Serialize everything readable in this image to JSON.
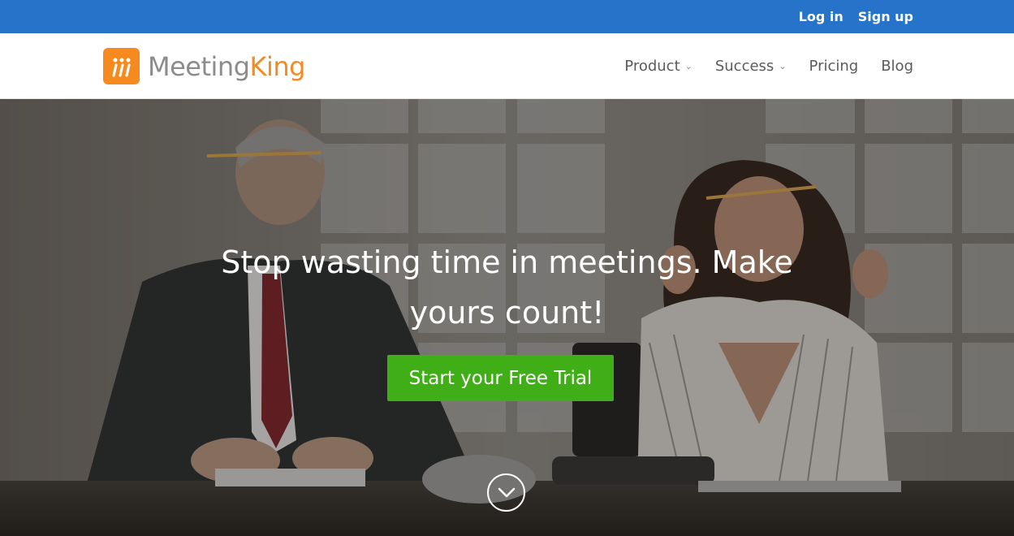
{
  "topbar": {
    "login": "Log in",
    "signup": "Sign up",
    "color": "#2673c9"
  },
  "brand": {
    "logo_mark": "m",
    "name_part1": "Meeting",
    "name_part2": "King",
    "accent": "#f68a1e"
  },
  "nav": {
    "items": [
      {
        "label": "Product",
        "has_dropdown": true
      },
      {
        "label": "Success",
        "has_dropdown": true
      },
      {
        "label": "Pricing",
        "has_dropdown": false
      },
      {
        "label": "Blog",
        "has_dropdown": false
      }
    ]
  },
  "hero": {
    "headline_line1": "Stop wasting time in meetings. Make",
    "headline_line2": "yours count!",
    "cta_label": "Start your Free Trial",
    "cta_color": "#3fae17",
    "scroll_icon": "chevron-down-circle-icon"
  }
}
